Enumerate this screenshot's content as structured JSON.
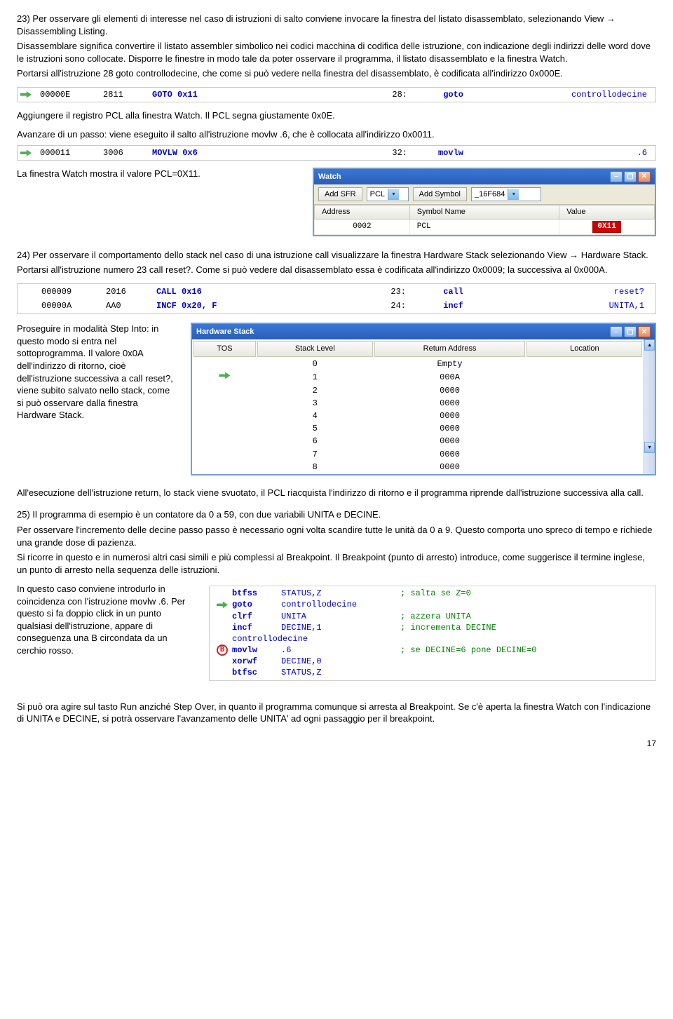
{
  "p23": {
    "line1": "23) Per osservare gli elementi di interesse nel caso di istruzioni di salto conviene invocare la finestra del listato disassemblato, selezionando View ",
    "arrow": "→",
    "line1b": " Disassembling Listing.",
    "line2": "Disassemblare significa convertire il listato assembler simbolico nei codici macchina di codifica delle istruzione, con indicazione degli indirizzi delle word dove le istruzioni sono collocate. Disporre le finestre in modo tale da poter osservare il programma, il listato disassemblato e la finestra Watch.",
    "line3": "Portarsi all'istruzione 28 goto controllodecine, che come si può vedere nella finestra del disassemblato, è codificata all'indirizzo 0x000E."
  },
  "dis1": {
    "addr": "00000E",
    "op": "2811",
    "mnem": "GOTO 0x11",
    "line": "28:",
    "kw": "goto",
    "sym": "controllodecine"
  },
  "p_pcl1": "Aggiungere il registro PCL alla finestra Watch.  Il PCL segna giustamente 0x0E.",
  "p_pcl2": "Avanzare di un passo: viene eseguito il salto all'istruzione movlw .6, che è collocata all'indirizzo 0x0011.",
  "dis2": {
    "addr": "000011",
    "op": "3006",
    "mnem": "MOVLW 0x6",
    "line": "32:",
    "kw": "movlw",
    "sym": ".6"
  },
  "p_watch": "La finestra Watch mostra il valore PCL=0X11.",
  "watch": {
    "title": "Watch",
    "addSFR": "Add SFR",
    "sfrVal": "PCL",
    "addSym": "Add Symbol",
    "symVal": "_16F684",
    "col_addr": "Address",
    "col_name": "Symbol Name",
    "col_val": "Value",
    "row_addr": "0002",
    "row_name": "PCL",
    "row_val": "0X11"
  },
  "p24": {
    "a": "24) Per osservare il comportamento dello stack nel caso di una istruzione call visualizzare la finestra Hardware Stack selezionando View ",
    "arrow": "→",
    "b": " Hardware Stack.",
    "c": "Portarsi all'istruzione numero 23 call reset?. Come si può vedere dal disassemblato essa è codificata all'indirizzo 0x0009; la successiva al 0x000A."
  },
  "dis3": [
    {
      "addr": "000009",
      "op": "2016",
      "mnem": "CALL 0x16",
      "line": "23:",
      "kw": "call",
      "sym": "reset?"
    },
    {
      "addr": "00000A",
      "op": "AA0",
      "mnem": "INCF 0x20, F",
      "line": "24:",
      "kw": "incf",
      "sym": "UNITA,1"
    }
  ],
  "p_step": "Proseguire in modalità Step Into: in questo modo si entra nel sottoprogramma. Il valore 0x0A dell'indirizzo di ritorno, cioè dell'istruzione successiva a call reset?, viene subito salvato nello stack, come si può osservare dalla finestra Hardware Stack.",
  "hstack": {
    "title": "Hardware Stack",
    "cols": [
      "TOS",
      "Stack Level",
      "Return Address",
      "Location"
    ],
    "rows": [
      {
        "tos": "",
        "lvl": "0",
        "ret": "Empty",
        "loc": ""
      },
      {
        "tos": "arrow",
        "lvl": "1",
        "ret": "000A",
        "loc": ""
      },
      {
        "tos": "",
        "lvl": "2",
        "ret": "0000",
        "loc": ""
      },
      {
        "tos": "",
        "lvl": "3",
        "ret": "0000",
        "loc": ""
      },
      {
        "tos": "",
        "lvl": "4",
        "ret": "0000",
        "loc": ""
      },
      {
        "tos": "",
        "lvl": "5",
        "ret": "0000",
        "loc": ""
      },
      {
        "tos": "",
        "lvl": "6",
        "ret": "0000",
        "loc": ""
      },
      {
        "tos": "",
        "lvl": "7",
        "ret": "0000",
        "loc": ""
      },
      {
        "tos": "",
        "lvl": "8",
        "ret": "0000",
        "loc": ""
      }
    ]
  },
  "p_return": "All'esecuzione dell'istruzione return, lo stack viene svuotato, il PCL riacquista l'indirizzo di ritorno e il programma riprende dall'istruzione successiva alla call.",
  "p25": {
    "a": "25) Il programma di esempio è un contatore da 0 a 59, con due variabili UNITA e DECINE.",
    "b": "Per osservare l'incremento delle decine passo passo è necessario ogni volta scandire tutte le unità da 0 a 9. Questo comporta uno spreco di tempo e richiede una grande dose di pazienza.",
    "c": "Si ricorre in questo e in numerosi altri casi simili e più complessi al Breakpoint. Il Breakpoint (punto di arresto) introduce, come suggerisce il termine inglese, un punto di arresto nella sequenza delle istruzioni."
  },
  "p_bp": "In questo caso conviene introdurlo in coincidenza con l'istruzione movlw   .6. Per questo si fa doppio click in un punto qualsiasi dell'istruzione, appare di conseguenza una B circondata da un cerchio rosso.",
  "asm": {
    "lines": [
      {
        "mark": "",
        "mnem": "btfss",
        "ops": "STATUS,Z",
        "c": "; salta se Z=0"
      },
      {
        "mark": "arrow",
        "mnem": "goto",
        "ops": "controllodecine",
        "c": ""
      },
      {
        "mark": "",
        "mnem": "clrf",
        "ops": "UNITA",
        "c": "; azzera UNITA"
      },
      {
        "mark": "",
        "mnem": "incf",
        "ops": "DECINE,1",
        "c": "; incrementa DECINE"
      },
      {
        "mark": "label",
        "label": "controllodecine",
        "c": ""
      },
      {
        "mark": "bp",
        "mnem": "movlw",
        "ops": ".6",
        "c": "; se DECINE=6 pone DECINE=0"
      },
      {
        "mark": "",
        "mnem": "xorwf",
        "ops": "DECINE,0",
        "c": ""
      },
      {
        "mark": "",
        "mnem": "btfsc",
        "ops": "STATUS,Z",
        "c": ""
      }
    ]
  },
  "p_run": "Si può ora agire sul tasto Run anziché Step Over, in quanto il programma comunque si arresta al Breakpoint. Se c'è aperta la finestra Watch con l'indicazione di UNITA e DECINE, si potrà osservare l'avanzamento delle UNITA' ad ogni passaggio per il breakpoint.",
  "pagenum": "17"
}
